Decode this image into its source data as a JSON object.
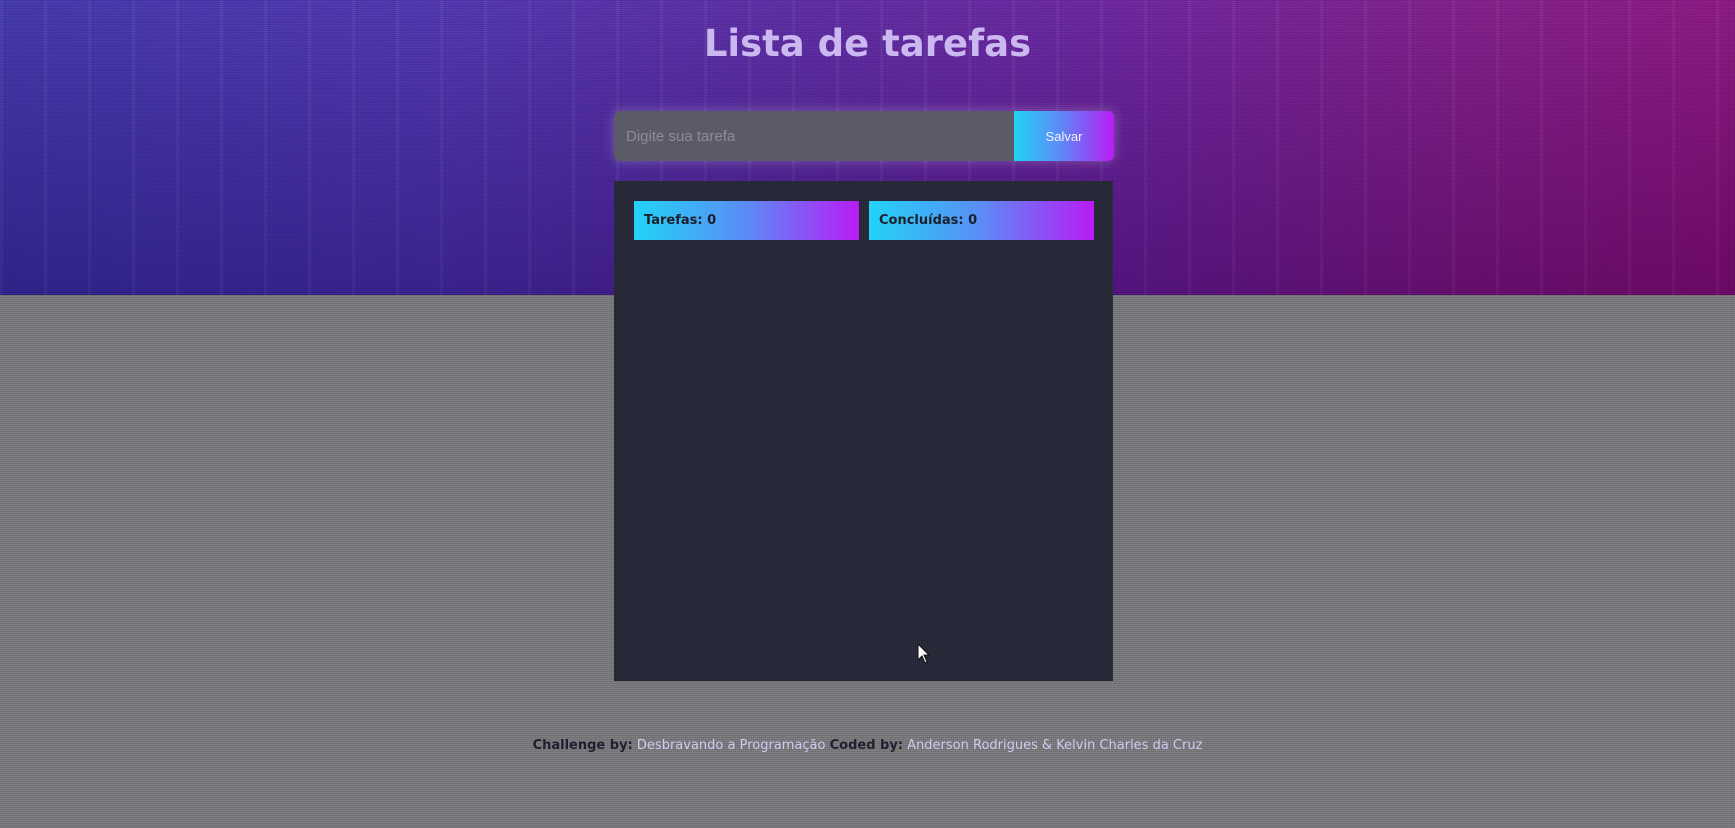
{
  "header": {
    "title": "Lista de tarefas"
  },
  "form": {
    "placeholder": "Digite sua tarefa",
    "save_label": "Salvar"
  },
  "counters": {
    "tasks_label": "Tarefas:",
    "tasks_value": "0",
    "done_label": "Concluídas:",
    "done_value": "0"
  },
  "footer": {
    "challenge_label": "Challenge by:",
    "challenge_author": "Desbravando a Programação",
    "coded_label": "Coded by:",
    "coded_authors": "Anderson Rodrigues & Kelvin Charles da Cruz"
  },
  "colors": {
    "accent_start": "#22d3f6",
    "accent_end": "#b81cf5",
    "panel_bg": "#262838",
    "hero_start": "#3d2fb6",
    "hero_end": "#900b86"
  },
  "icons": {
    "cursor": "mouse-pointer-icon"
  }
}
